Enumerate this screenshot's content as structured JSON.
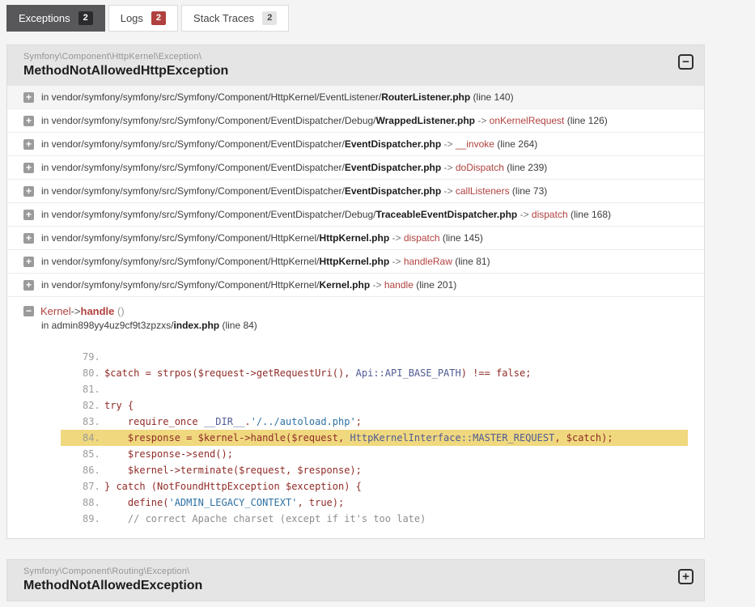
{
  "icons": {
    "plus": "+",
    "minus": "−"
  },
  "tabs": [
    {
      "label": "Exceptions",
      "count": "2",
      "badge": "dark",
      "active": true
    },
    {
      "label": "Logs",
      "count": "2",
      "badge": "red",
      "active": false
    },
    {
      "label": "Stack Traces",
      "count": "2",
      "badge": "light",
      "active": false
    }
  ],
  "exceptions": [
    {
      "namespace": "Symfony\\Component\\HttpKernel\\Exception\\",
      "name": "MethodNotAllowedHttpException",
      "toggle_glyph": "−",
      "traces": [
        {
          "prefix": "in vendor/symfony/symfony/src/Symfony/Component/HttpKernel/EventListener/",
          "file": "RouterListener.php",
          "method": "",
          "line": "(line 140)"
        },
        {
          "prefix": "in vendor/symfony/symfony/src/Symfony/Component/EventDispatcher/Debug/",
          "file": "WrappedListener.php",
          "method": "onKernelRequest",
          "line": "(line 126)"
        },
        {
          "prefix": "in vendor/symfony/symfony/src/Symfony/Component/EventDispatcher/",
          "file": "EventDispatcher.php",
          "method": "__invoke",
          "line": "(line 264)"
        },
        {
          "prefix": "in vendor/symfony/symfony/src/Symfony/Component/EventDispatcher/",
          "file": "EventDispatcher.php",
          "method": "doDispatch",
          "line": "(line 239)"
        },
        {
          "prefix": "in vendor/symfony/symfony/src/Symfony/Component/EventDispatcher/",
          "file": "EventDispatcher.php",
          "method": "callListeners",
          "line": "(line 73)"
        },
        {
          "prefix": "in vendor/symfony/symfony/src/Symfony/Component/EventDispatcher/Debug/",
          "file": "TraceableEventDispatcher.php",
          "method": "dispatch",
          "line": "(line 168)"
        },
        {
          "prefix": "in vendor/symfony/symfony/src/Symfony/Component/HttpKernel/",
          "file": "HttpKernel.php",
          "method": "dispatch",
          "line": "(line 145)"
        },
        {
          "prefix": "in vendor/symfony/symfony/src/Symfony/Component/HttpKernel/",
          "file": "HttpKernel.php",
          "method": "handleRaw",
          "line": "(line 81)"
        },
        {
          "prefix": "in vendor/symfony/symfony/src/Symfony/Component/HttpKernel/",
          "file": "Kernel.php",
          "method": "handle",
          "line": "(line 201)"
        }
      ],
      "expanded_trace": {
        "class": "Kernel",
        "arrow": "->",
        "method": "handle",
        "args": "()",
        "location_prefix": "in admin898yy4uz9cf9t3zpzxs/",
        "location_file": "index.php",
        "location_line": " (line 84)",
        "code": [
          {
            "num": "79.",
            "highlight": false,
            "segments": []
          },
          {
            "num": "80.",
            "highlight": false,
            "segments": [
              {
                "t": "$catch = strpos($request->getRequestUri(), ",
                "s": "code"
              },
              {
                "t": "Api::API_BASE_PATH",
                "s": "const"
              },
              {
                "t": ") !== false;",
                "s": "code"
              }
            ]
          },
          {
            "num": "81.",
            "highlight": false,
            "segments": []
          },
          {
            "num": "82.",
            "highlight": false,
            "segments": [
              {
                "t": "try {",
                "s": "code"
              }
            ]
          },
          {
            "num": "83.",
            "highlight": false,
            "segments": [
              {
                "t": "    require_once ",
                "s": "code"
              },
              {
                "t": "__DIR__",
                "s": "const"
              },
              {
                "t": ".",
                "s": "code"
              },
              {
                "t": "'/../autoload.php'",
                "s": "str"
              },
              {
                "t": ";",
                "s": "code"
              }
            ]
          },
          {
            "num": "84.",
            "highlight": true,
            "segments": [
              {
                "t": "    $response = $kernel->handle($request, ",
                "s": "code"
              },
              {
                "t": "HttpKernelInterface::MASTER_REQUEST",
                "s": "const"
              },
              {
                "t": ", $catch);",
                "s": "code"
              }
            ]
          },
          {
            "num": "85.",
            "highlight": false,
            "segments": [
              {
                "t": "    $response->send();",
                "s": "code"
              }
            ]
          },
          {
            "num": "86.",
            "highlight": false,
            "segments": [
              {
                "t": "    $kernel->terminate($request, $response);",
                "s": "code"
              }
            ]
          },
          {
            "num": "87.",
            "highlight": false,
            "segments": [
              {
                "t": "} catch (NotFoundHttpException $exception) {",
                "s": "code"
              }
            ]
          },
          {
            "num": "88.",
            "highlight": false,
            "segments": [
              {
                "t": "    define(",
                "s": "code"
              },
              {
                "t": "'ADMIN_LEGACY_CONTEXT'",
                "s": "str"
              },
              {
                "t": ", true);",
                "s": "code"
              }
            ]
          },
          {
            "num": "89.",
            "highlight": false,
            "segments": [
              {
                "t": "    // correct Apache charset (except if it's too late)",
                "s": "comment"
              }
            ]
          }
        ]
      }
    },
    {
      "namespace": "Symfony\\Component\\Routing\\Exception\\",
      "name": "MethodNotAllowedException",
      "toggle_glyph": "+"
    }
  ]
}
